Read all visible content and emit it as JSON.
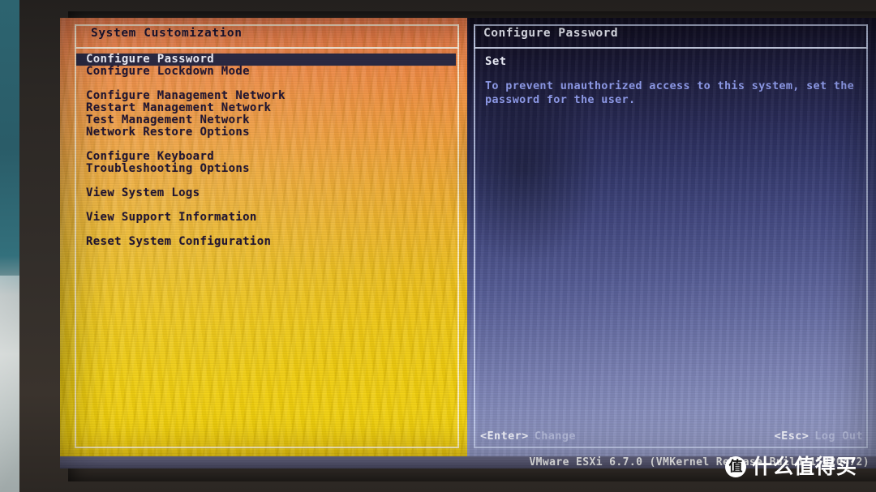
{
  "scene": {
    "description": "photo-of-monitor",
    "bezel_color": "#2f2a26",
    "backdrop_color": "#2d6470"
  },
  "left_pane": {
    "title": "System Customization",
    "accent_start": "#e8774a",
    "accent_end": "#f3d20f",
    "selected_index": 0,
    "groups": [
      [
        "Configure Password",
        "Configure Lockdown Mode"
      ],
      [
        "Configure Management Network",
        "Restart Management Network",
        "Test Management Network",
        "Network Restore Options"
      ],
      [
        "Configure Keyboard",
        "Troubleshooting Options"
      ],
      [
        "View System Logs"
      ],
      [
        "View Support Information"
      ],
      [
        "Reset System Configuration"
      ]
    ],
    "items_flat": [
      "Configure Password",
      "Configure Lockdown Mode",
      "Configure Management Network",
      "Restart Management Network",
      "Test Management Network",
      "Network Restore Options",
      "Configure Keyboard",
      "Troubleshooting Options",
      "View System Logs",
      "View Support Information",
      "Reset System Configuration"
    ],
    "selection_bg": "#2b2a44",
    "selection_fg": "#f2f2fb"
  },
  "right_pane": {
    "title": "Configure Password",
    "subhead": "Set",
    "description_lines": [
      "To prevent unauthorized access to this system, set the",
      "password for the user."
    ],
    "bg_start": "#100d1d",
    "bg_end": "#9096bf",
    "hints": [
      {
        "key": "<Enter>",
        "action": "Change"
      },
      {
        "key": "<Esc>",
        "action": "Log Out"
      }
    ]
  },
  "status_bar": {
    "text": "VMware ESXi 6.7.0 (VMKernel Release Build 15820472)",
    "bg": "#5f5f7c",
    "fg": "#ffffff"
  },
  "watermark": {
    "badge": "值",
    "text": "什么值得买"
  }
}
